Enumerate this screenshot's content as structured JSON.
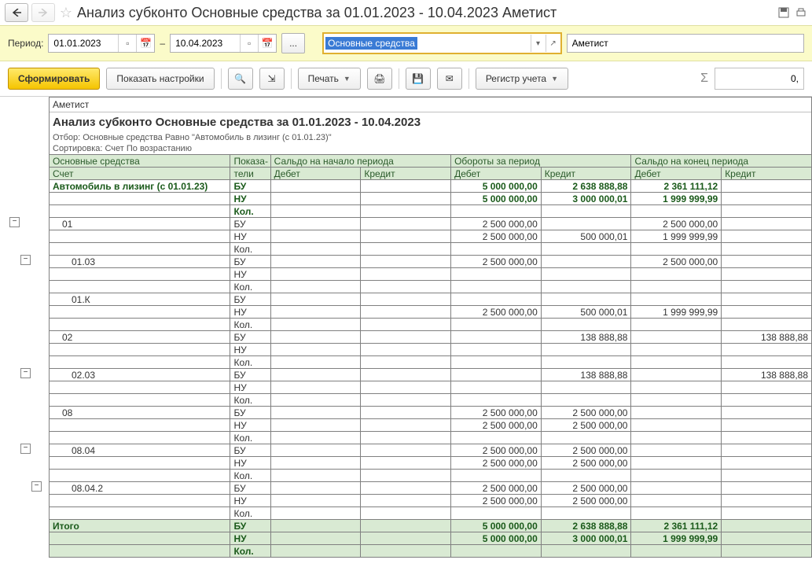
{
  "title": "Анализ субконто Основные средства за 01.01.2023 - 10.04.2023 Аметист",
  "period": {
    "label": "Период:",
    "from": "01.01.2023",
    "dash": "–",
    "to": "10.04.2023"
  },
  "combo": {
    "value": "Основные средства"
  },
  "org": "Аметист",
  "buttons": {
    "form": "Сформировать",
    "settings": "Показать настройки",
    "print": "Печать",
    "registry": "Регистр учета"
  },
  "sigma_value": "0,",
  "report": {
    "org": "Аметист",
    "title": "Анализ субконто Основные средства за 01.01.2023 - 10.04.2023",
    "filter": "Отбор: Основные средства Равно \"Автомобиль в лизинг (с 01.01.23)\"",
    "sort": "Сортировка: Счет По возрастанию"
  },
  "headers": {
    "subj": "Основные средства",
    "acct": "Счет",
    "ind": "Показа-",
    "ind2": "тели",
    "start": "Сальдо на начало периода",
    "turn": "Обороты за период",
    "end": "Сальдо на конец периода",
    "debit": "Дебет",
    "credit": "Кредит"
  },
  "kinds": {
    "bu": "БУ",
    "nu": "НУ",
    "kol": "Кол."
  },
  "rows": [
    {
      "name": "Автомобиль в лизинг (с 01.01.23)",
      "indent": 0,
      "bold": true,
      "bu": {
        "td": "5 000 000,00",
        "tc": "2 638 888,88",
        "ed": "2 361 111,12"
      },
      "nu": {
        "td": "5 000 000,00",
        "tc": "3 000 000,01",
        "ed": "1 999 999,99"
      },
      "kol": {}
    },
    {
      "name": "01",
      "indent": 1,
      "bu": {
        "td": "2 500 000,00",
        "ed": "2 500 000,00"
      },
      "nu": {
        "td": "2 500 000,00",
        "tc": "500 000,01",
        "ed": "1 999 999,99"
      },
      "kol": {}
    },
    {
      "name": "01.03",
      "indent": 2,
      "bu": {
        "td": "2 500 000,00",
        "ed": "2 500 000,00"
      },
      "nu": {},
      "kol": {}
    },
    {
      "name": "01.К",
      "indent": 2,
      "bu": {},
      "nu": {
        "td": "2 500 000,00",
        "tc": "500 000,01",
        "ed": "1 999 999,99"
      },
      "kol": {}
    },
    {
      "name": "02",
      "indent": 1,
      "bu": {
        "tc": "138 888,88",
        "ec": "138 888,88"
      },
      "nu": {},
      "kol": {}
    },
    {
      "name": "02.03",
      "indent": 2,
      "bu": {
        "tc": "138 888,88",
        "ec": "138 888,88"
      },
      "nu": {},
      "kol": {}
    },
    {
      "name": "08",
      "indent": 1,
      "bu": {
        "td": "2 500 000,00",
        "tc": "2 500 000,00"
      },
      "nu": {
        "td": "2 500 000,00",
        "tc": "2 500 000,00"
      },
      "kol": {}
    },
    {
      "name": "08.04",
      "indent": 2,
      "bu": {
        "td": "2 500 000,00",
        "tc": "2 500 000,00"
      },
      "nu": {
        "td": "2 500 000,00",
        "tc": "2 500 000,00"
      },
      "kol": {}
    },
    {
      "name": "08.04.2",
      "indent": 2,
      "bu": {
        "td": "2 500 000,00",
        "tc": "2 500 000,00"
      },
      "nu": {
        "td": "2 500 000,00",
        "tc": "2 500 000,00"
      },
      "kol": {}
    }
  ],
  "total": {
    "name": "Итого",
    "bu": {
      "td": "5 000 000,00",
      "tc": "2 638 888,88",
      "ed": "2 361 111,12"
    },
    "nu": {
      "td": "5 000 000,00",
      "tc": "3 000 000,01",
      "ed": "1 999 999,99"
    },
    "kol": {}
  }
}
